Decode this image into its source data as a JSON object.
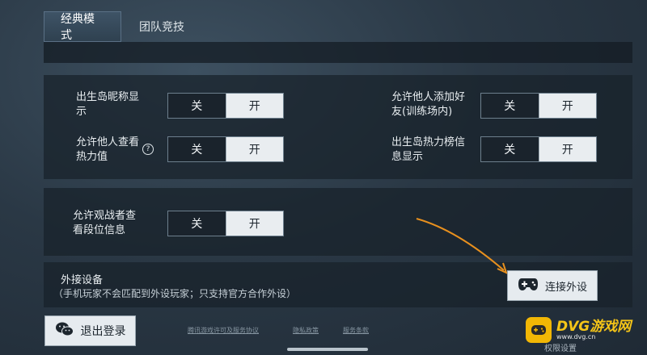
{
  "tabs": [
    {
      "label": "经典模式",
      "active": true
    },
    {
      "label": "团队竞技",
      "active": false
    }
  ],
  "settings": [
    {
      "label": "出生岛昵称显示",
      "off": "关",
      "on": "开"
    },
    {
      "label": "允许他人添加好友(训练场内)",
      "off": "关",
      "on": "开"
    },
    {
      "label": "允许他人查看热力值",
      "off": "关",
      "on": "开",
      "help": "?"
    },
    {
      "label": "出生岛热力榜信息显示",
      "off": "关",
      "on": "开"
    },
    {
      "label": "允许观战者查看段位信息",
      "off": "关",
      "on": "开"
    }
  ],
  "device": {
    "title": "外接设备",
    "note": "（手机玩家不会匹配到外设玩家；只支持官方合作外设）",
    "connect_label": "连接外设"
  },
  "logout_label": "退出登录",
  "footer_links": [
    "腾讯游戏许可及服务协议",
    "隐私政策",
    "服务条款"
  ],
  "footer_tab": "权限设置",
  "watermark": {
    "brand": "DVG游戏网",
    "url": "www.dvg.cn"
  },
  "colors": {
    "accent_arrow": "#e8901e",
    "watermark": "#f2b705"
  }
}
